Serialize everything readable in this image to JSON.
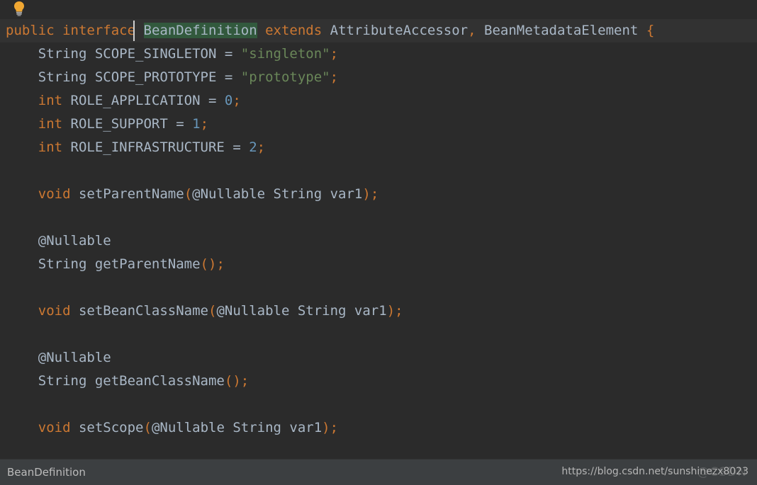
{
  "window": {
    "title": "BeanDefinition",
    "theme_background": "#2b2b2b",
    "current_line_background": "#323232",
    "foreground": "#a9b7c6"
  },
  "toolbar": {
    "intention_bulb_icon": "lightbulb-icon",
    "intention_bulb_color": "#f0a732"
  },
  "editor": {
    "colors": {
      "keyword": "#cc7832",
      "string": "#6a8759",
      "number": "#6897bb",
      "identifier": "#a9b7c6",
      "punctuation": "#cc7832",
      "identifier_highlight": "#32593d",
      "caret": "#d0d0d0"
    },
    "lines": [
      {
        "current": true,
        "caret": true,
        "tokens": [
          {
            "t": "public",
            "c": "kw"
          },
          {
            "t": " ",
            "c": "id"
          },
          {
            "t": "interface",
            "c": "kw"
          },
          {
            "t": " ",
            "c": "id"
          },
          {
            "t": "BeanDefinition",
            "c": "id hl"
          },
          {
            "t": " ",
            "c": "id"
          },
          {
            "t": "extends",
            "c": "kw"
          },
          {
            "t": " ",
            "c": "id"
          },
          {
            "t": "AttributeAccessor",
            "c": "id"
          },
          {
            "t": ",",
            "c": "punc"
          },
          {
            "t": " ",
            "c": "id"
          },
          {
            "t": "BeanMetadataElement",
            "c": "id"
          },
          {
            "t": " ",
            "c": "id"
          },
          {
            "t": "{",
            "c": "punc"
          }
        ]
      },
      {
        "tokens": [
          {
            "t": "    ",
            "c": "id"
          },
          {
            "t": "String",
            "c": "id"
          },
          {
            "t": " SCOPE_SINGLETON ",
            "c": "id"
          },
          {
            "t": "=",
            "c": "id"
          },
          {
            "t": " ",
            "c": "id"
          },
          {
            "t": "\"singleton\"",
            "c": "str"
          },
          {
            "t": ";",
            "c": "punc"
          }
        ]
      },
      {
        "tokens": [
          {
            "t": "    ",
            "c": "id"
          },
          {
            "t": "String",
            "c": "id"
          },
          {
            "t": " SCOPE_PROTOTYPE ",
            "c": "id"
          },
          {
            "t": "=",
            "c": "id"
          },
          {
            "t": " ",
            "c": "id"
          },
          {
            "t": "\"prototype\"",
            "c": "str"
          },
          {
            "t": ";",
            "c": "punc"
          }
        ]
      },
      {
        "tokens": [
          {
            "t": "    ",
            "c": "id"
          },
          {
            "t": "int",
            "c": "kw"
          },
          {
            "t": " ROLE_APPLICATION ",
            "c": "id"
          },
          {
            "t": "=",
            "c": "id"
          },
          {
            "t": " ",
            "c": "id"
          },
          {
            "t": "0",
            "c": "num"
          },
          {
            "t": ";",
            "c": "punc"
          }
        ]
      },
      {
        "tokens": [
          {
            "t": "    ",
            "c": "id"
          },
          {
            "t": "int",
            "c": "kw"
          },
          {
            "t": " ROLE_SUPPORT ",
            "c": "id"
          },
          {
            "t": "=",
            "c": "id"
          },
          {
            "t": " ",
            "c": "id"
          },
          {
            "t": "1",
            "c": "num"
          },
          {
            "t": ";",
            "c": "punc"
          }
        ]
      },
      {
        "tokens": [
          {
            "t": "    ",
            "c": "id"
          },
          {
            "t": "int",
            "c": "kw"
          },
          {
            "t": " ROLE_INFRASTRUCTURE ",
            "c": "id"
          },
          {
            "t": "=",
            "c": "id"
          },
          {
            "t": " ",
            "c": "id"
          },
          {
            "t": "2",
            "c": "num"
          },
          {
            "t": ";",
            "c": "punc"
          }
        ]
      },
      {
        "tokens": []
      },
      {
        "tokens": [
          {
            "t": "    ",
            "c": "id"
          },
          {
            "t": "void",
            "c": "kw"
          },
          {
            "t": " setParentName",
            "c": "id"
          },
          {
            "t": "(",
            "c": "punc"
          },
          {
            "t": "@Nullable",
            "c": "annot"
          },
          {
            "t": " String var1",
            "c": "id"
          },
          {
            "t": ")",
            "c": "punc"
          },
          {
            "t": ";",
            "c": "punc"
          }
        ]
      },
      {
        "tokens": []
      },
      {
        "tokens": [
          {
            "t": "    ",
            "c": "id"
          },
          {
            "t": "@Nullable",
            "c": "annot"
          }
        ]
      },
      {
        "tokens": [
          {
            "t": "    ",
            "c": "id"
          },
          {
            "t": "String getParentName",
            "c": "id"
          },
          {
            "t": "()",
            "c": "punc"
          },
          {
            "t": ";",
            "c": "punc"
          }
        ]
      },
      {
        "tokens": []
      },
      {
        "tokens": [
          {
            "t": "    ",
            "c": "id"
          },
          {
            "t": "void",
            "c": "kw"
          },
          {
            "t": " setBeanClassName",
            "c": "id"
          },
          {
            "t": "(",
            "c": "punc"
          },
          {
            "t": "@Nullable",
            "c": "annot"
          },
          {
            "t": " String var1",
            "c": "id"
          },
          {
            "t": ")",
            "c": "punc"
          },
          {
            "t": ";",
            "c": "punc"
          }
        ]
      },
      {
        "tokens": []
      },
      {
        "tokens": [
          {
            "t": "    ",
            "c": "id"
          },
          {
            "t": "@Nullable",
            "c": "annot"
          }
        ]
      },
      {
        "tokens": [
          {
            "t": "    ",
            "c": "id"
          },
          {
            "t": "String getBeanClassName",
            "c": "id"
          },
          {
            "t": "()",
            "c": "punc"
          },
          {
            "t": ";",
            "c": "punc"
          }
        ]
      },
      {
        "tokens": []
      },
      {
        "tokens": [
          {
            "t": "    ",
            "c": "id"
          },
          {
            "t": "void",
            "c": "kw"
          },
          {
            "t": " setScope",
            "c": "id"
          },
          {
            "t": "(",
            "c": "punc"
          },
          {
            "t": "@Nullable",
            "c": "annot"
          },
          {
            "t": " String var1",
            "c": "id"
          },
          {
            "t": ")",
            "c": "punc"
          },
          {
            "t": ";",
            "c": "punc"
          }
        ]
      }
    ]
  },
  "statusbar": {
    "breadcrumb": "BeanDefinition",
    "watermark": "https://blog.csdn.net/sunshinezx8023",
    "watermark_ghost": "@CSDN"
  }
}
